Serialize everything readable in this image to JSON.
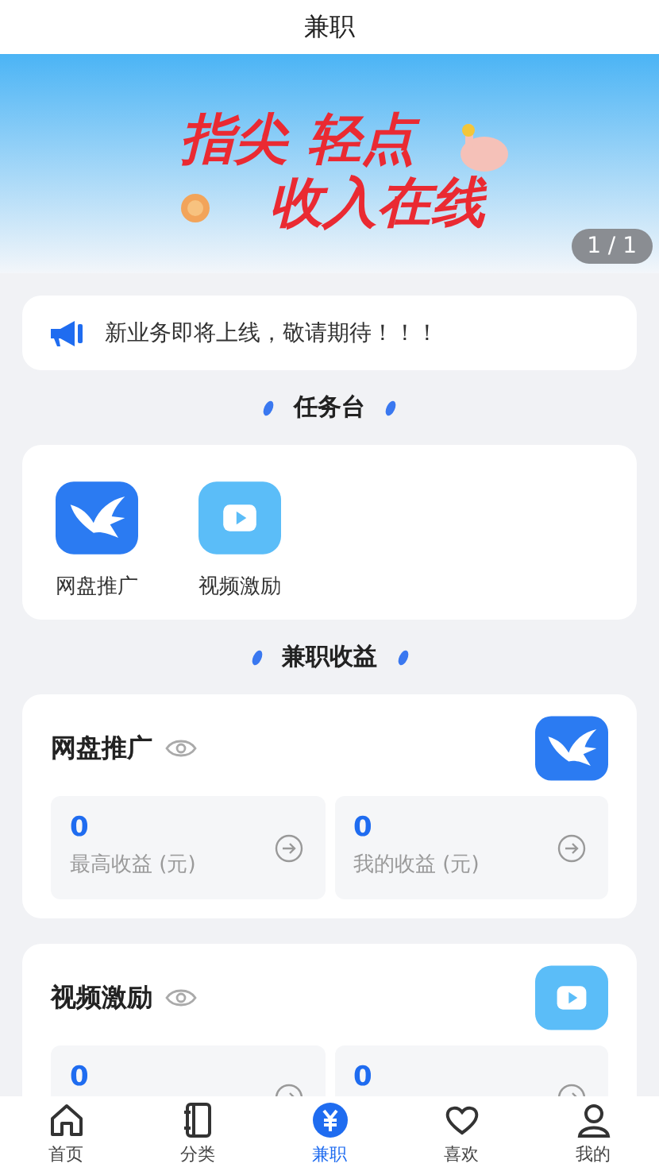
{
  "header": {
    "title": "兼职"
  },
  "banner": {
    "headline_1": "指尖 轻点",
    "headline_2": "收入在线",
    "counter": "1 / 1"
  },
  "notice": {
    "text": "新业务即将上线，敬请期待！！！"
  },
  "task_section": {
    "title": "任务台",
    "items": [
      {
        "label": "网盘推广",
        "kind": "bird"
      },
      {
        "label": "视频激励",
        "kind": "video"
      }
    ]
  },
  "income_section": {
    "title": "兼职收益",
    "cards": [
      {
        "title": "网盘推广",
        "kind": "bird",
        "stats": [
          {
            "value": "0",
            "label": "最高收益 (元)"
          },
          {
            "value": "0",
            "label": "我的收益 (元)"
          }
        ]
      },
      {
        "title": "视频激励",
        "kind": "video",
        "stats": [
          {
            "value": "0"
          },
          {
            "value": "0"
          }
        ]
      }
    ]
  },
  "tab_bar": [
    {
      "label": "首页",
      "kind": "home",
      "selected": false
    },
    {
      "label": "分类",
      "kind": "book",
      "selected": false
    },
    {
      "label": "兼职",
      "kind": "yuan",
      "selected": true
    },
    {
      "label": "喜欢",
      "kind": "heart",
      "selected": false
    },
    {
      "label": "我的",
      "kind": "user",
      "selected": false
    }
  ]
}
